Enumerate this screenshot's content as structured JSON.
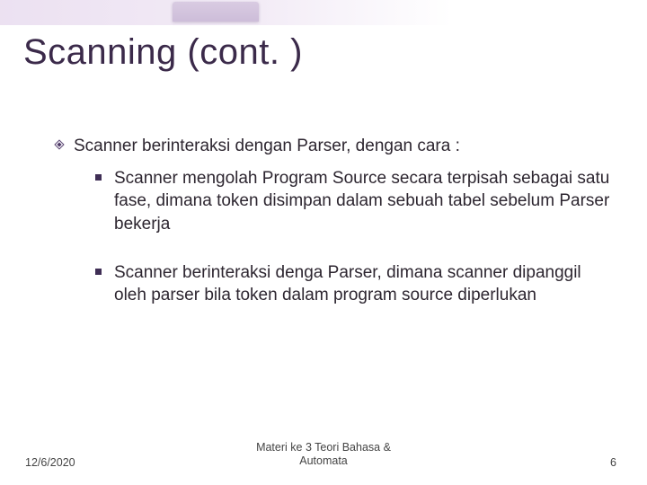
{
  "title": "Scanning (cont. )",
  "bullets": {
    "main": "Scanner berinteraksi dengan Parser, dengan cara :",
    "sub1": "Scanner mengolah Program Source secara terpisah sebagai satu fase, dimana token disimpan dalam sebuah tabel sebelum Parser bekerja",
    "sub2": "Scanner berinteraksi denga Parser, dimana scanner dipanggil oleh parser bila token dalam program source diperlukan"
  },
  "footer": {
    "date": "12/6/2020",
    "center": "Materi ke 3 Teori Bahasa &\nAutomata",
    "page": "6"
  }
}
